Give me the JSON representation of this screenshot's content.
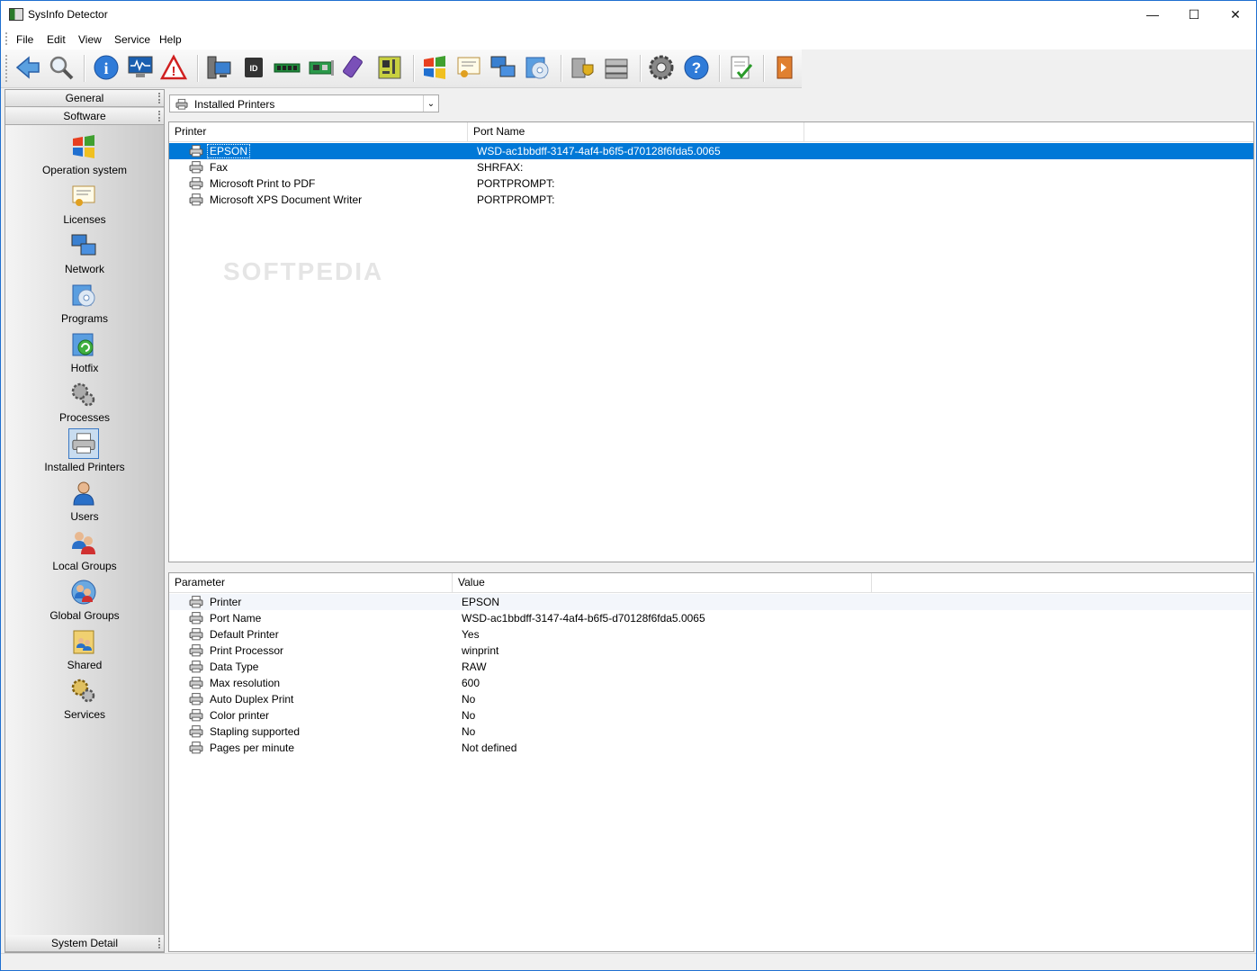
{
  "window": {
    "title": "SysInfo Detector",
    "controls": [
      "—",
      "☐",
      "✕"
    ]
  },
  "menu": [
    "File",
    "Edit",
    "View",
    "Service",
    "Help"
  ],
  "toolbar": [
    "back-icon",
    "search-icon",
    "info-icon",
    "monitor-icon",
    "warning-icon",
    "computer-icon",
    "cpu-id-icon",
    "memory-icon",
    "pci-card-icon",
    "usb-icon",
    "motherboard-icon",
    "windows-icon",
    "certificate-icon",
    "network-icon",
    "programs-icon",
    "security-icon",
    "drives-icon",
    "settings-icon",
    "help-icon",
    "report-icon",
    "exit-icon"
  ],
  "side": {
    "general": "General",
    "software": "Software",
    "system_detail": "System Detail",
    "items": [
      "Operation system",
      "Licenses",
      "Network",
      "Programs",
      "Hotfix",
      "Processes",
      "Installed Printers",
      "Users",
      "Local Groups",
      "Global Groups",
      "Shared",
      "Services"
    ],
    "selected": "Installed Printers"
  },
  "combo": {
    "value": "Installed Printers"
  },
  "printers": {
    "columns": [
      "Printer",
      "Port Name"
    ],
    "rows": [
      [
        "EPSON",
        "WSD-ac1bbdff-3147-4af4-b6f5-d70128f6fda5.0065"
      ],
      [
        "Fax",
        "SHRFAX:"
      ],
      [
        "Microsoft Print to PDF",
        "PORTPROMPT:"
      ],
      [
        "Microsoft XPS Document Writer",
        "PORTPROMPT:"
      ]
    ]
  },
  "details": {
    "columns": [
      "Parameter",
      "Value"
    ],
    "rows": [
      [
        "Printer",
        "EPSON"
      ],
      [
        "Port Name",
        "WSD-ac1bbdff-3147-4af4-b6f5-d70128f6fda5.0065"
      ],
      [
        "Default Printer",
        "Yes"
      ],
      [
        "Print Processor",
        "winprint"
      ],
      [
        "Data Type",
        "RAW"
      ],
      [
        "Max resolution",
        "600"
      ],
      [
        "Auto Duplex Print",
        "No"
      ],
      [
        "Color printer",
        "No"
      ],
      [
        "Stapling supported",
        "No"
      ],
      [
        "Pages per minute",
        "Not defined"
      ]
    ]
  },
  "watermark": "SOFTPEDIA"
}
